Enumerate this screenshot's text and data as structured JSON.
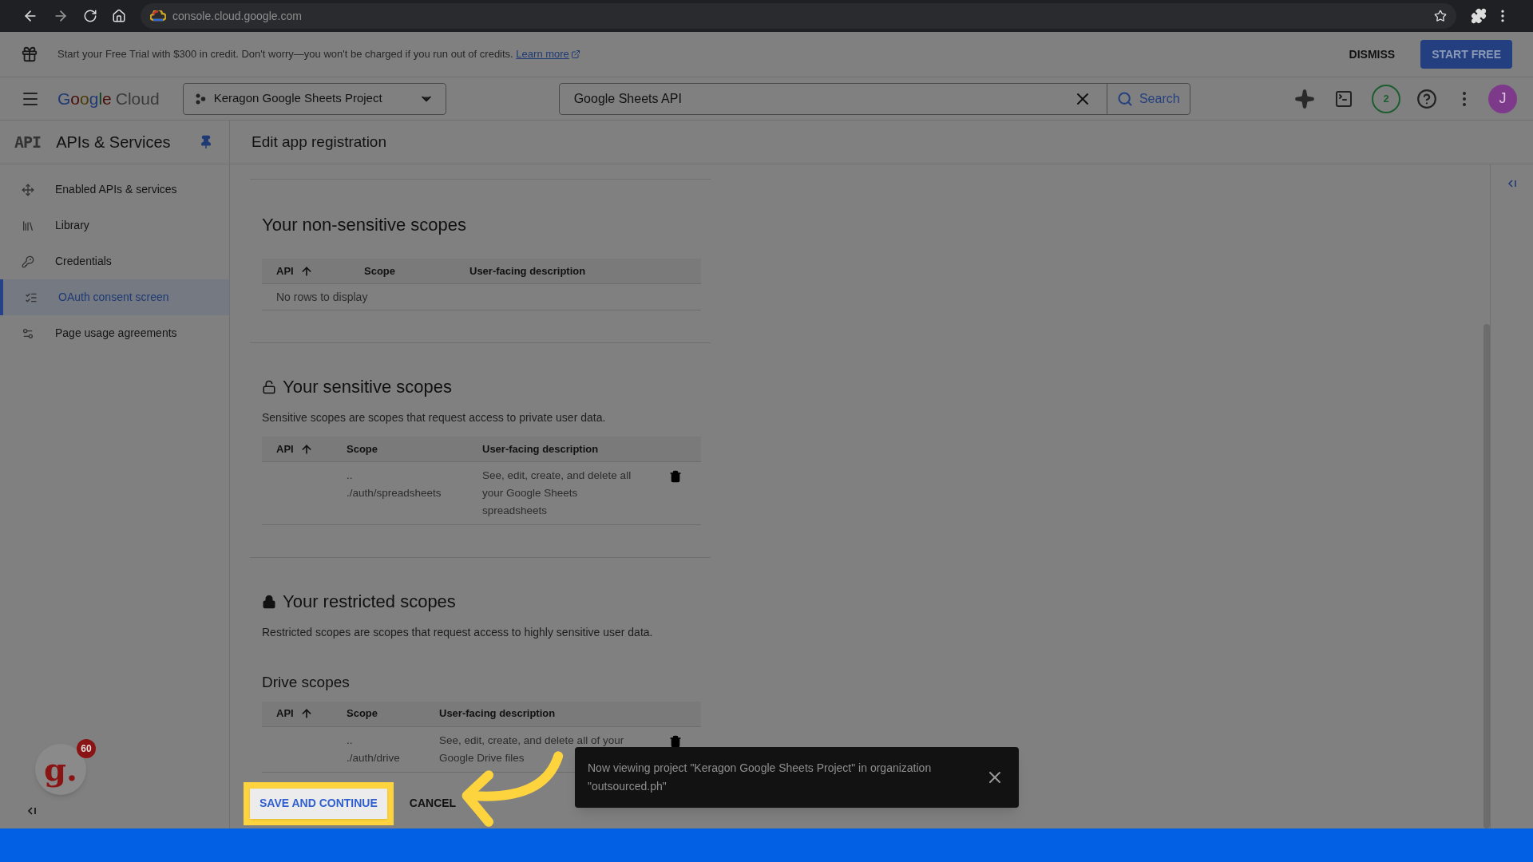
{
  "browser": {
    "url": "console.cloud.google.com"
  },
  "banner": {
    "text": "Start your Free Trial with $300 in credit. Don't worry—you won't be charged if you run out of credits.",
    "link": "Learn more",
    "dismiss": "DISMISS",
    "start": "START FREE"
  },
  "topnav": {
    "logo_word": "Google",
    "logo_product": "Cloud",
    "project": "Keragon Google Sheets Project",
    "search": {
      "value": "Google Sheets API",
      "button": "Search"
    },
    "notifications": "2",
    "avatar": "J"
  },
  "sidebar": {
    "title_icon": "API",
    "title": "APIs & Services",
    "items": [
      {
        "label": "Enabled APIs & services",
        "selected": false
      },
      {
        "label": "Library",
        "selected": false
      },
      {
        "label": "Credentials",
        "selected": false
      },
      {
        "label": "OAuth consent screen",
        "selected": true
      },
      {
        "label": "Page usage agreements",
        "selected": false
      }
    ]
  },
  "page": {
    "title": "Edit app registration"
  },
  "non_sensitive": {
    "title": "Your non-sensitive scopes",
    "columns": [
      "API",
      "Scope",
      "User-facing description"
    ],
    "empty": "No rows to display"
  },
  "sensitive": {
    "title": "Your sensitive scopes",
    "description": "Sensitive scopes are scopes that request access to private user data.",
    "columns": [
      "API",
      "Scope",
      "User-facing description"
    ],
    "rows": [
      {
        "scope": "..\n./auth/spreadsheets",
        "description": "See, edit, create, and delete all your Google Sheets spreadsheets"
      }
    ]
  },
  "restricted": {
    "title": "Your restricted scopes",
    "description": "Restricted scopes are scopes that request access to highly sensitive user data.",
    "subtitle": "Drive scopes",
    "columns": [
      "API",
      "Scope",
      "User-facing description"
    ],
    "rows": [
      {
        "scope": "..\n./auth/drive",
        "description": "See, edit, create, and delete all of your Google Drive files"
      }
    ]
  },
  "actions": {
    "save": "SAVE AND CONTINUE",
    "cancel": "CANCEL"
  },
  "toast": {
    "message": "Now viewing project \"Keragon Google Sheets Project\" in organization \"outsourced.ph\""
  },
  "badge": {
    "letter": "g.",
    "count": "60"
  }
}
